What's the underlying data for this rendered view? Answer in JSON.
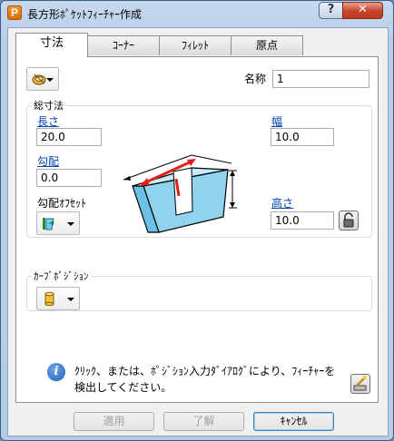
{
  "window": {
    "title": "長方形ﾎﾟｹｯﾄﾌｨｰﾁｬｰ作成",
    "app_icon_letter": "P",
    "help_label": "?",
    "close_label": "✕"
  },
  "tabs": [
    {
      "label": "寸法",
      "active": true
    },
    {
      "label": "ｺｰﾅｰ",
      "active": false
    },
    {
      "label": "ﾌｨﾚｯﾄ",
      "active": false
    },
    {
      "label": "原点",
      "active": false
    }
  ],
  "name": {
    "label": "名称",
    "value": "1"
  },
  "dimensions": {
    "group_title": "総寸法",
    "length": {
      "label": "長さ",
      "value": "20.0"
    },
    "width": {
      "label": "幅",
      "value": "10.0"
    },
    "draft": {
      "label": "勾配",
      "value": "0.0"
    },
    "draft_offset": {
      "label": "勾配ｵﾌｾｯﾄ"
    },
    "height": {
      "label": "高さ",
      "value": "10.0"
    }
  },
  "curve_position": {
    "group_title": "ｶｰﾌﾞﾎﾟｼﾞｼｮﾝ"
  },
  "info": {
    "message_line1": "ｸﾘｯｸ、または、ﾎﾟｼﾞｼｮﾝ入力ﾀﾞｲｱﾛｸﾞにより、ﾌｨｰﾁｬｰを",
    "message_line2": "検出してください。"
  },
  "buttons": {
    "apply": "適用",
    "ok": "了解",
    "cancel": "ｷｬﾝｾﾙ"
  },
  "colors": {
    "pocket_fill": "#8fd3ee",
    "pocket_edge": "#000000",
    "arrow_red": "#e0201b",
    "link": "#0645ad"
  },
  "icons": {
    "feature_type": "pocket-feature-icon",
    "draft_offset": "draft-offset-icon",
    "curve_position": "cylinder-icon",
    "height_lock": "lock-icon",
    "wizard": "wizard-icon"
  }
}
